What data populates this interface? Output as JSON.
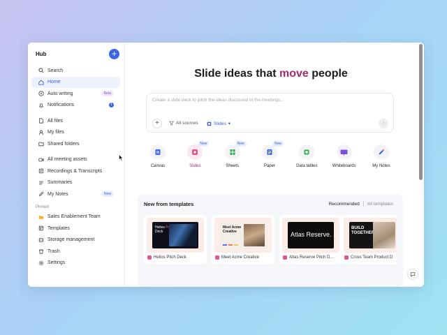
{
  "sidebar": {
    "title": "Hub",
    "new_button": "+",
    "items": [
      {
        "label": "Search",
        "icon": "search-icon"
      },
      {
        "label": "Home",
        "icon": "home-icon",
        "active": true
      },
      {
        "label": "Auto writing",
        "icon": "auto-writing-icon",
        "tag": "Beta"
      },
      {
        "label": "Notifications",
        "icon": "bell-icon",
        "badge": "1"
      },
      {
        "label": "All files",
        "icon": "file-icon"
      },
      {
        "label": "My files",
        "icon": "user-icon"
      },
      {
        "label": "Shared folders",
        "icon": "folder-icon"
      },
      {
        "label": "All meeting assets",
        "icon": "meeting-icon"
      },
      {
        "label": "Recordings & Transcripts",
        "icon": "recording-icon"
      },
      {
        "label": "Summaries",
        "icon": "summary-icon"
      },
      {
        "label": "My Notes",
        "icon": "notes-icon",
        "tag": "New"
      }
    ],
    "pinned_label": "Pinned",
    "pinned": [
      {
        "label": "Sales Enablement Team",
        "icon": "folder-yellow-icon"
      },
      {
        "label": "Templates",
        "icon": "templates-icon"
      },
      {
        "label": "Storage management",
        "icon": "storage-icon"
      },
      {
        "label": "Trash",
        "icon": "trash-icon"
      },
      {
        "label": "Settings",
        "icon": "gear-icon"
      }
    ]
  },
  "main": {
    "headline_before": "Slide ideas that ",
    "headline_accent": "move",
    "headline_after": " people",
    "prompt_placeholder": "Create a slide deck to pitch the ideas discussed in the meetings...",
    "sources_label": "All sources",
    "mode_label": "Slides",
    "types": [
      {
        "label": "Canvas",
        "icon": "canvas-icon",
        "color": "#3b64e8"
      },
      {
        "label": "Slides",
        "icon": "slides-icon",
        "color": "#e0568f",
        "new": "New",
        "active": true
      },
      {
        "label": "Sheets",
        "icon": "sheets-icon",
        "color": "#2fa84f",
        "new": "New"
      },
      {
        "label": "Paper",
        "icon": "paper-icon",
        "color": "#3b64e8",
        "new": "New"
      },
      {
        "label": "Data tables",
        "icon": "data-tables-icon",
        "color": "#2fa84f"
      },
      {
        "label": "Whiteboards",
        "icon": "whiteboard-icon",
        "color": "#7c4ee0"
      },
      {
        "label": "My Notes",
        "icon": "my-notes-icon",
        "color": "#3b64e8"
      }
    ],
    "templates": {
      "title": "New from templates",
      "tab_recommended": "Recommended",
      "tab_all": "All templates",
      "cards": [
        {
          "caption": "Helios Pitch Deck",
          "slide_line1": "Helios",
          "slide_accent": "Pitch",
          "slide_line2": "Deck"
        },
        {
          "caption": "Meet Acme Creative",
          "slide_line1": "Meet Acme",
          "slide_line2": "Creative"
        },
        {
          "caption": "Atlas Reserve Pitch D...",
          "slide_line1": "Atlas Reserve."
        },
        {
          "caption": "Cross Team Product D",
          "slide_line1": "BUILD",
          "slide_line2": "TOGETHER"
        }
      ]
    }
  },
  "colors": {
    "accent": "#3b64e8",
    "headline_accent": "#a12b6b"
  }
}
